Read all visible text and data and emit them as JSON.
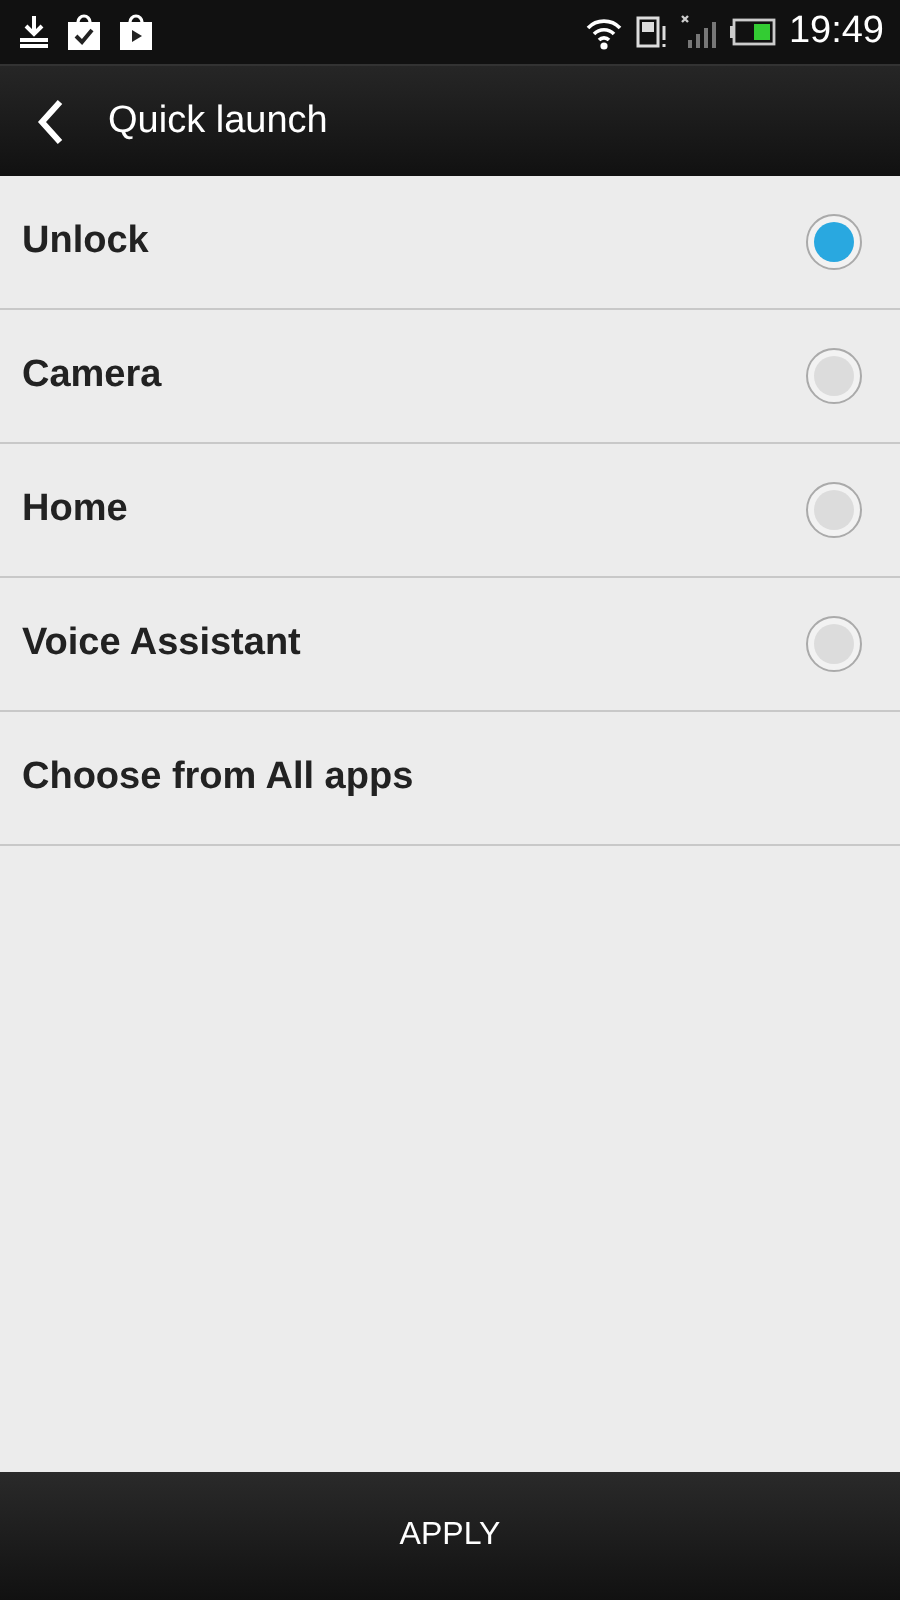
{
  "status_bar": {
    "time": "19:49"
  },
  "header": {
    "title": "Quick launch"
  },
  "options": [
    {
      "label": "Unlock",
      "kind": "radio",
      "selected": true
    },
    {
      "label": "Camera",
      "kind": "radio",
      "selected": false
    },
    {
      "label": "Home",
      "kind": "radio",
      "selected": false
    },
    {
      "label": "Voice Assistant",
      "kind": "radio",
      "selected": false
    },
    {
      "label": "Choose from All apps",
      "kind": "link"
    }
  ],
  "footer": {
    "button": "APPLY"
  }
}
